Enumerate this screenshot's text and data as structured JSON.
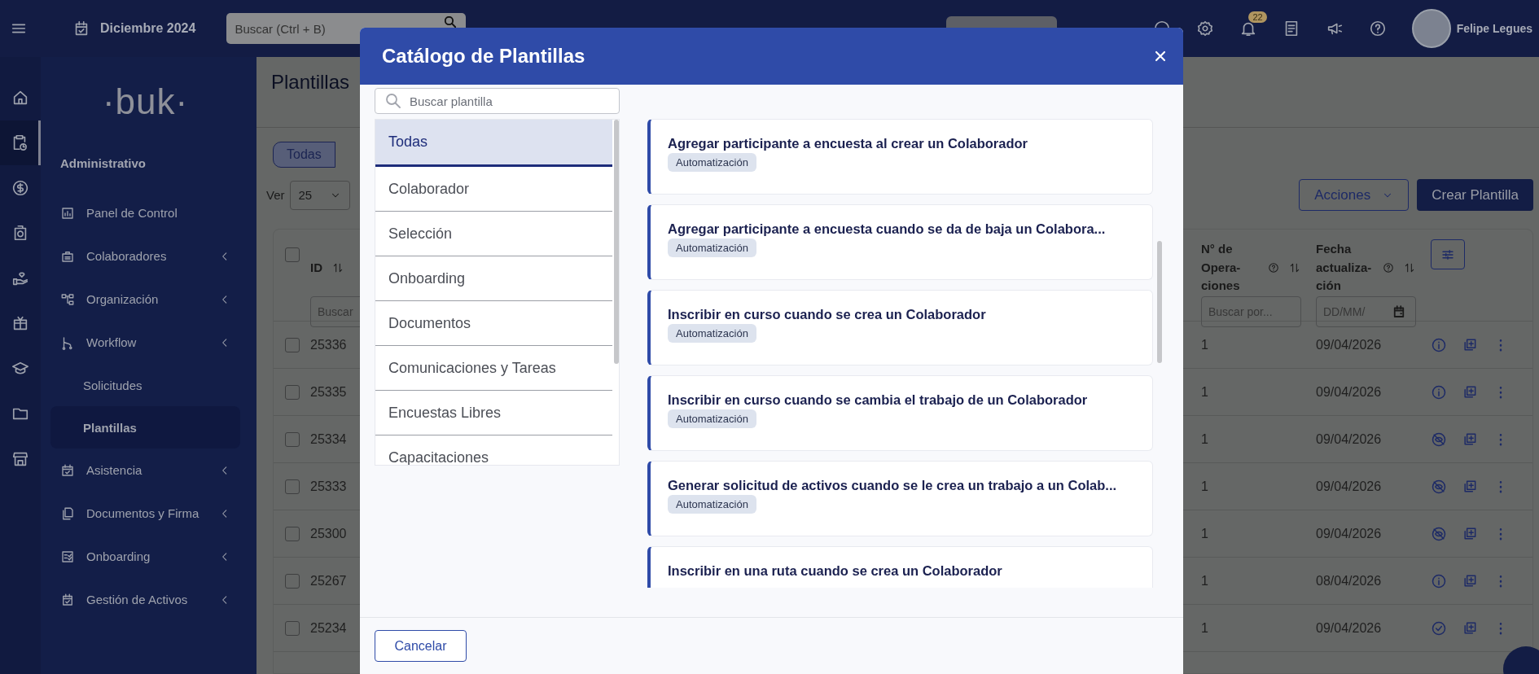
{
  "top_bar": {
    "month": "Diciembre 2024",
    "search": {
      "placeholder": "Buscar (Ctrl + B)"
    },
    "notifications": "22",
    "user": "Felipe Legues"
  },
  "sidebar": {
    "logo": "·buk·",
    "section": "Administrativo",
    "items": [
      {
        "label": "Panel de Control",
        "expandable": false,
        "selected": false
      },
      {
        "label": "Colaboradores",
        "expandable": true,
        "selected": false
      },
      {
        "label": "Organización",
        "expandable": true,
        "selected": false
      },
      {
        "label": "Workflow",
        "expandable": true,
        "selected": false,
        "children": [
          {
            "label": "Solicitudes",
            "selected": false
          },
          {
            "label": "Plantillas",
            "selected": true
          }
        ]
      },
      {
        "label": "Asistencia",
        "expandable": true,
        "selected": false
      },
      {
        "label": "Documentos y Firma",
        "expandable": true,
        "selected": false
      },
      {
        "label": "Onboarding",
        "expandable": true,
        "selected": false
      },
      {
        "label": "Gestión de Activos",
        "expandable": true,
        "selected": false
      }
    ]
  },
  "page": {
    "title": "Plantillas",
    "tabs": [
      {
        "label": "Todas",
        "selected": true
      }
    ],
    "per_page_label": "Ver",
    "per_page": "25",
    "actions_button": "Acciones",
    "create_button": "Crear Plantilla",
    "table": {
      "select_all_checked": false,
      "columns": [
        {
          "label": "ID",
          "placeholder": "Buscar",
          "kind": "text"
        },
        {
          "label": "N° de Opera-ciones",
          "placeholder": "Buscar por...",
          "kind": "text"
        },
        {
          "label": "Fecha actualiza-ción",
          "placeholder": "DD/MM/",
          "kind": "date"
        }
      ],
      "rows": [
        {
          "checked": false,
          "id": "25336",
          "operations": "1",
          "date": "09/04/2026",
          "kind": "info"
        },
        {
          "checked": false,
          "id": "25335",
          "operations": "1",
          "date": "09/04/2026",
          "kind": "info"
        },
        {
          "checked": false,
          "id": "25334",
          "operations": "1",
          "date": "09/04/2026",
          "kind": "hidden"
        },
        {
          "checked": false,
          "id": "25333",
          "operations": "1",
          "date": "09/04/2026",
          "kind": "hidden"
        },
        {
          "checked": false,
          "id": "25300",
          "operations": "1",
          "date": "09/04/2026",
          "kind": "hidden"
        },
        {
          "checked": false,
          "id": "25267",
          "operations": "1",
          "date": "08/04/2026",
          "kind": "info"
        },
        {
          "checked": false,
          "id": "25234",
          "operations": "1",
          "date": "09/04/2026",
          "kind": "check"
        }
      ]
    }
  },
  "modal": {
    "title": "Catálogo de Plantillas",
    "search": {
      "placeholder": "Buscar plantilla"
    },
    "categories": [
      {
        "label": "Todas",
        "selected": true
      },
      {
        "label": "Colaborador",
        "selected": false
      },
      {
        "label": "Selección",
        "selected": false
      },
      {
        "label": "Onboarding",
        "selected": false
      },
      {
        "label": "Documentos",
        "selected": false
      },
      {
        "label": "Comunicaciones y Tareas",
        "selected": false
      },
      {
        "label": "Encuestas Libres",
        "selected": false
      },
      {
        "label": "Capacitaciones",
        "selected": false
      }
    ],
    "templates": [
      {
        "title": "Agregar participante a encuesta al crear un Colaborador",
        "tag": "Automatización"
      },
      {
        "title": "Agregar participante a encuesta cuando se da de baja un Colabora...",
        "tag": "Automatización"
      },
      {
        "title": "Inscribir en curso cuando se crea un Colaborador",
        "tag": "Automatización"
      },
      {
        "title": "Inscribir en curso cuando se cambia el trabajo de un Colaborador",
        "tag": "Automatización"
      },
      {
        "title": "Generar solicitud de activos cuando se le crea un trabajo a un Colab...",
        "tag": "Automatización"
      },
      {
        "title": "Inscribir en una ruta cuando se crea un Colaborador"
      }
    ],
    "cancel_button": "Cancelar"
  }
}
